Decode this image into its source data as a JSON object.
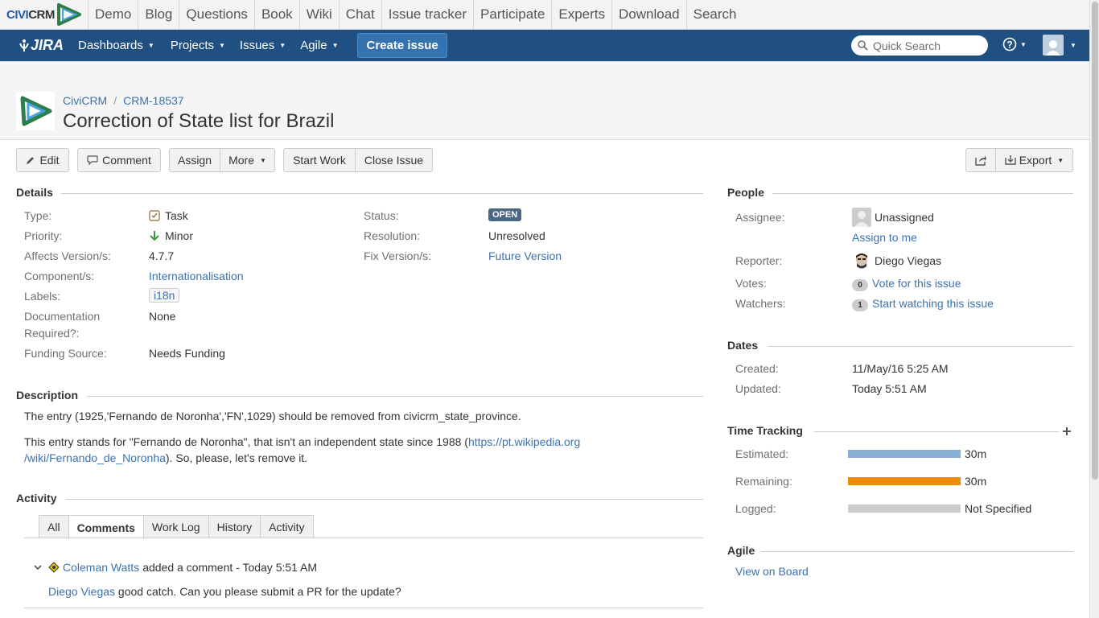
{
  "civi": {
    "logo_a": "CIVI",
    "logo_b": "CRM",
    "nav": [
      "Demo",
      "Blog",
      "Questions",
      "Book",
      "Wiki",
      "Chat",
      "Issue tracker",
      "Participate",
      "Experts",
      "Download",
      "Search"
    ]
  },
  "jira": {
    "logo": "JIRA",
    "nav": [
      "Dashboards",
      "Projects",
      "Issues",
      "Agile"
    ],
    "create_label": "Create issue",
    "search_placeholder": "Quick Search",
    "help_icon": "help-icon"
  },
  "breadcrumb": {
    "project": "CiviCRM",
    "issue_key": "CRM-18537",
    "separator": "/"
  },
  "issue_title": "Correction of State list for Brazil",
  "toolbar": {
    "edit": "Edit",
    "comment": "Comment",
    "assign": "Assign",
    "more": "More",
    "start_work": "Start Work",
    "close_issue": "Close Issue",
    "export": "Export"
  },
  "details": {
    "heading": "Details",
    "type_label": "Type:",
    "type_value": "Task",
    "priority_label": "Priority:",
    "priority_value": "Minor",
    "affects_label": "Affects Version/s:",
    "affects_value": "4.7.7",
    "component_label": "Component/s:",
    "component_value": "Internationalisation",
    "labels_label": "Labels:",
    "labels_value": "i18n",
    "doc_label_1": "Documentation",
    "doc_label_2": "Required?:",
    "doc_value": "None",
    "funding_label": "Funding Source:",
    "funding_value": "Needs Funding",
    "status_label": "Status:",
    "status_value": "OPEN",
    "resolution_label": "Resolution:",
    "resolution_value": "Unresolved",
    "fix_label": "Fix Version/s:",
    "fix_value": "Future Version"
  },
  "description": {
    "heading": "Description",
    "p1": "The entry (1925,'Fernando de Noronha','FN',1029) should be removed from civicrm_state_province.",
    "p2_before": "This entry stands for \"Fernando de Noronha\", that isn't an independent state since 1988 (",
    "p2_link_1": "https://pt.wikipedia.org",
    "p2_link_2": "/wiki/Fernando_de_Noronha",
    "p2_after": "). So, please, let's remove it."
  },
  "activity": {
    "heading": "Activity",
    "tabs": [
      "All",
      "Comments",
      "Work Log",
      "History",
      "Activity"
    ],
    "comment_author": "Coleman Watts",
    "comment_meta": "added a comment - Today 5:51 AM",
    "comment_mention": "Diego Viegas",
    "comment_text": "good catch. Can you please submit a PR for the update?"
  },
  "people": {
    "heading": "People",
    "assignee_label": "Assignee:",
    "assignee_value": "Unassigned",
    "assign_to_me": "Assign to me",
    "reporter_label": "Reporter:",
    "reporter_value": "Diego Viegas",
    "votes_label": "Votes:",
    "votes_count": "0",
    "votes_link": "Vote for this issue",
    "watchers_label": "Watchers:",
    "watchers_count": "1",
    "watchers_link": "Start watching this issue"
  },
  "dates": {
    "heading": "Dates",
    "created_label": "Created:",
    "created_value": "11/May/16 5:25 AM",
    "updated_label": "Updated:",
    "updated_value": "Today 5:51 AM"
  },
  "time_tracking": {
    "heading": "Time Tracking",
    "estimated_label": "Estimated:",
    "estimated_value": "30m",
    "estimated_fill": 1.0,
    "remaining_label": "Remaining:",
    "remaining_value": "30m",
    "remaining_fill": 1.0,
    "logged_label": "Logged:",
    "logged_value": "Not Specified",
    "logged_fill": 0.0,
    "colors": {
      "estimated": "#89afd7",
      "remaining": "#ec8e00",
      "logged": "#cccccc"
    }
  },
  "agile": {
    "heading": "Agile",
    "link": "View on Board"
  }
}
